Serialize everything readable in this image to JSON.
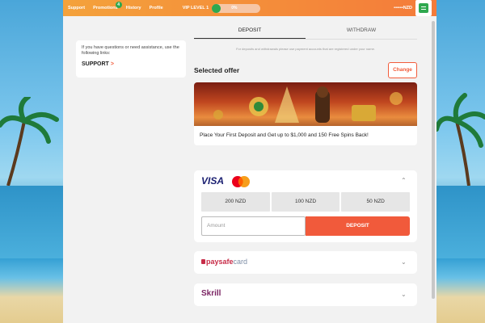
{
  "topbar": {
    "nav": [
      "Support",
      "Promotions",
      "History",
      "Profile"
    ],
    "promotions_badge": "4",
    "vip_label": "VIP LEVEL 1",
    "vip_progress_percent": 0,
    "vip_progress_text": "0%",
    "balance": "••••••NZD"
  },
  "support": {
    "text": "If you have questions or need assistance, use the following links:",
    "link_label": "SUPPORT",
    "link_chevron": ">"
  },
  "tabs": [
    "DEPOSIT",
    "WITHDRAW"
  ],
  "note": "For deposits and withdrawals please use payment accounts that are registered under your name.",
  "offer": {
    "heading": "Selected offer",
    "change_label": "Change",
    "text": "Place Your First Deposit and Get up to $1,000 and 150 Free Spins Back!"
  },
  "visa": {
    "logo": "VISA",
    "amounts": [
      "200 NZD",
      "100 NZD",
      "50 NZD"
    ],
    "amount_placeholder": "Amount",
    "deposit_label": "DEPOSIT"
  },
  "paysafe": {
    "logo_main": "paysafe",
    "logo_light": "card"
  },
  "skrill": {
    "logo": "Skrill"
  },
  "colors": {
    "accent": "#f25c3b",
    "topbar": "#f47b3a",
    "green": "#2fa84f"
  }
}
